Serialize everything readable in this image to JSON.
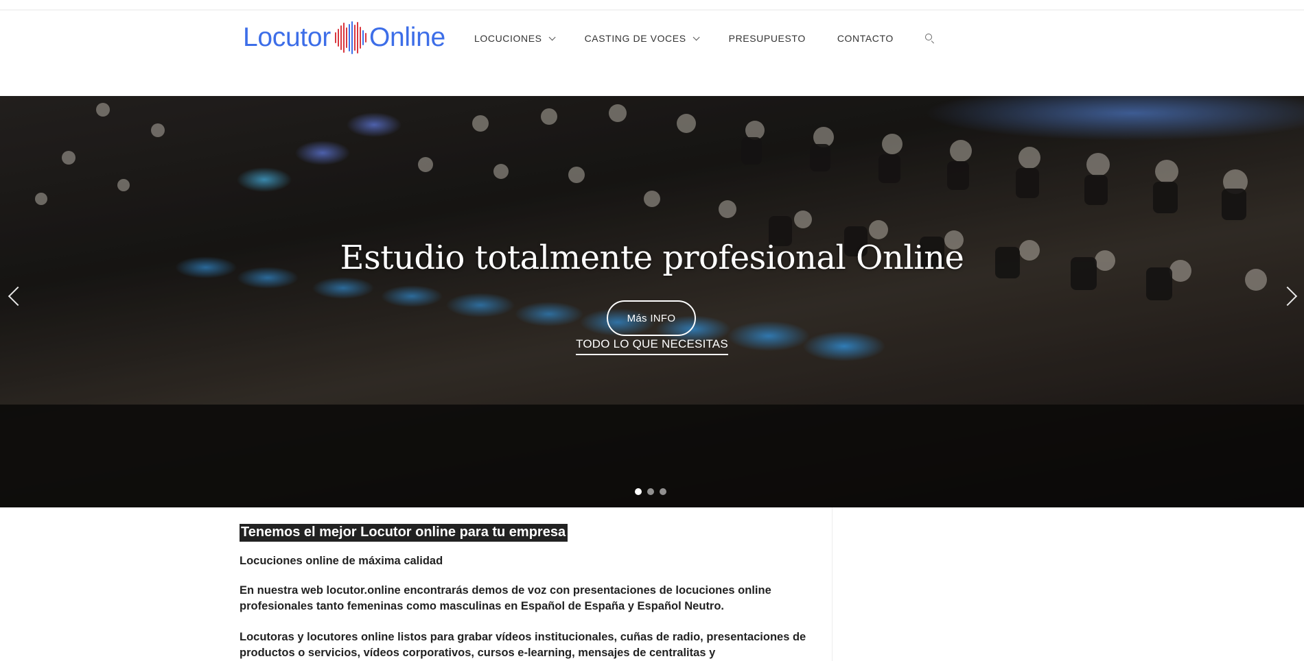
{
  "header": {
    "logo": {
      "part1": "Locutor",
      "part2": "Online",
      "colors": {
        "text": "#3d6ee8",
        "wave": "#d9363e"
      }
    },
    "nav": [
      {
        "label": "LOCUCIONES",
        "dropdown": true
      },
      {
        "label": "CASTING DE VOCES",
        "dropdown": true
      },
      {
        "label": "PRESUPUESTO",
        "dropdown": false
      },
      {
        "label": "CONTACTO",
        "dropdown": false
      }
    ],
    "search_icon": "search-icon"
  },
  "hero": {
    "title": "Estudio totalmente profesional Online",
    "button_label": "Más INFO",
    "subtitle": "TODO LO QUE NECESITAS",
    "slides_total": 3,
    "active_slide": 1,
    "prev_icon": "chevron-left-icon",
    "next_icon": "chevron-right-icon"
  },
  "content": {
    "heading": "Tenemos el mejor Locutor online para tu empresa",
    "subheading": "Locuciones online de máxima calidad",
    "paragraphs": [
      "En nuestra web locutor.online encontrarás demos de voz con presentaciones de locuciones online profesionales tanto femeninas como masculinas en Español de España y Español Neutro.",
      "Locutoras y locutores online listos para grabar vídeos institucionales, cuñas de radio, presentaciones de productos o servicios, vídeos corporativos, cursos e-learning, mensajes de centralitas y"
    ]
  }
}
